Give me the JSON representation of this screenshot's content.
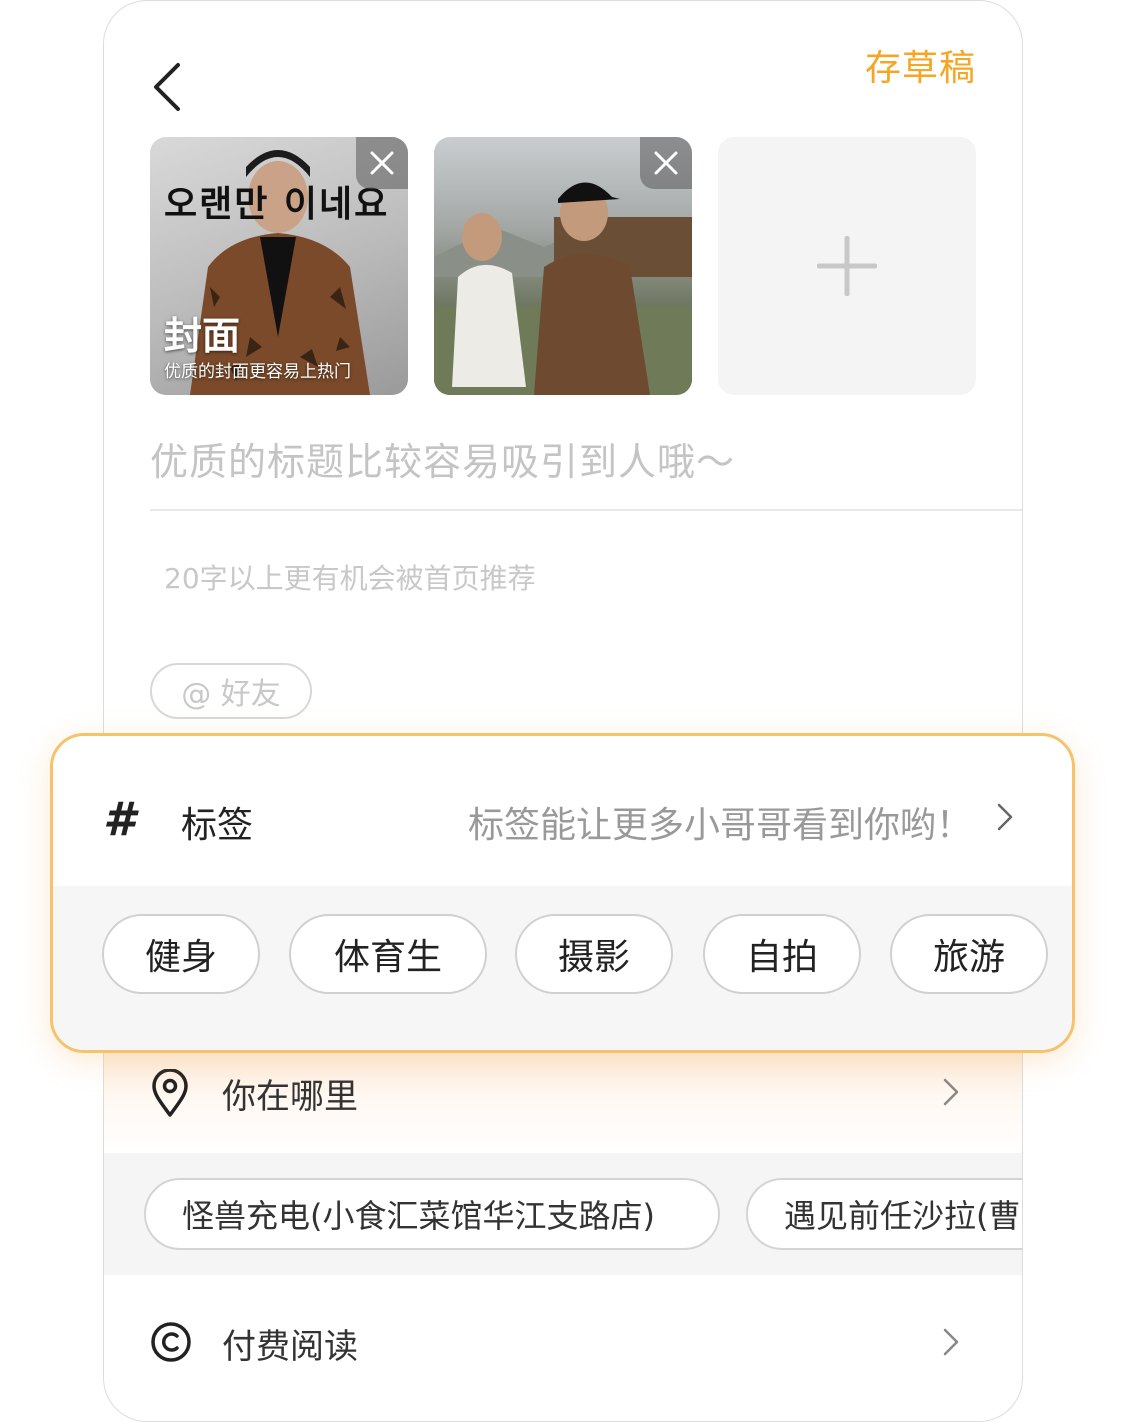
{
  "header": {
    "draft_label": "存草稿"
  },
  "images": {
    "cover_label": "封面",
    "cover_hint": "优质的封面更容易上热门",
    "cover_overlay_text": "오랜만 이네요"
  },
  "title_placeholder": "优质的标题比较容易吸引到人哦～",
  "desc_placeholder": "20字以上更有机会被首页推荐",
  "mention_label": "@ 好友",
  "tags": {
    "label": "标签",
    "hint": "标签能让更多小哥哥看到你哟！",
    "items": [
      "健身",
      "体育生",
      "摄影",
      "自拍",
      "旅游"
    ]
  },
  "location": {
    "label": "你在哪里",
    "items": [
      "怪兽充电(小食汇菜馆华江支路店)",
      "遇见前任沙拉(曹"
    ]
  },
  "paid": {
    "label": "付费阅读"
  },
  "colors": {
    "accent": "#f5a623",
    "highlight_border": "#f6c26b"
  }
}
